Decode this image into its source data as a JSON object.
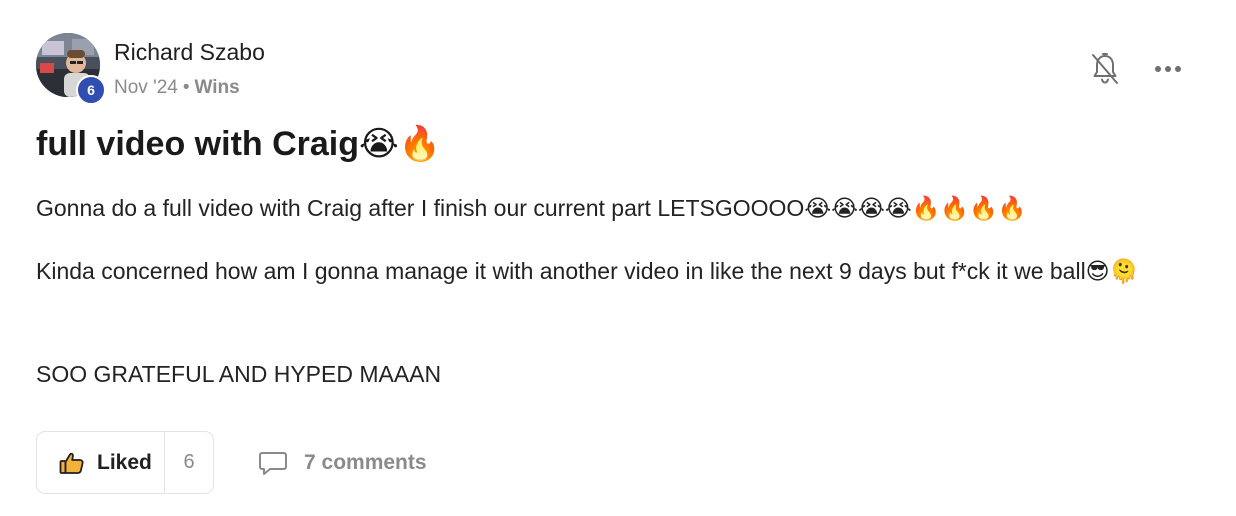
{
  "author": {
    "name": "Richard Szabo",
    "level": "6",
    "avatar_icon": "user-avatar-photo"
  },
  "meta": {
    "date": "Nov '24",
    "separator": "•",
    "category": "Wins"
  },
  "actions": {
    "bell_icon": "bell-off-icon",
    "more_icon": "more-horizontal-icon"
  },
  "post": {
    "title": "full video with Craig😭🔥",
    "paragraphs": [
      "Gonna do a full video with Craig after I finish our current part LETSGOOOO😭😭😭😭🔥🔥🔥🔥",
      "Kinda concerned how am I gonna manage it with another video in like the next 9 days but f*ck it we ball😎🫠",
      "SOO GRATEFUL AND HYPED MAAAN"
    ]
  },
  "footer": {
    "like_label": "Liked",
    "like_count": "6",
    "like_icon": "thumbs-up-icon",
    "comments_label": "7 comments",
    "comments_icon": "comment-icon"
  },
  "colors": {
    "badge": "#2f4eb0",
    "text": "#1f1f1f",
    "muted": "#8a8a8a",
    "border": "#e3e3e3"
  }
}
